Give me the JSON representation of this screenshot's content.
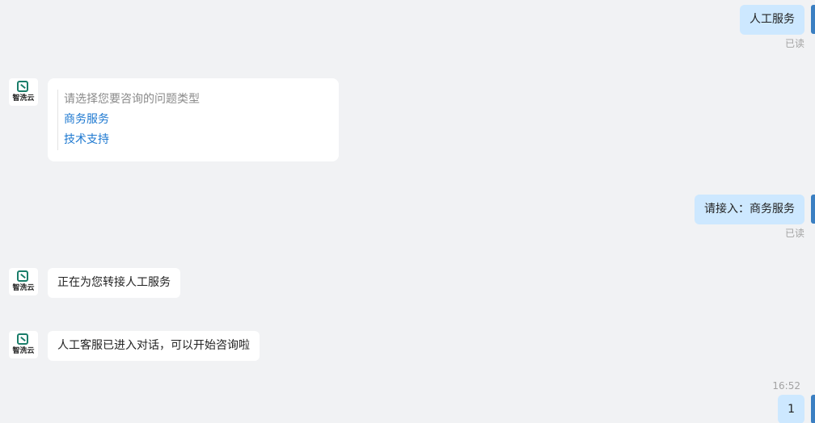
{
  "bot": {
    "name": "智洗云"
  },
  "read_label": "已读",
  "messages": {
    "m1": {
      "sender": "user",
      "text": "人工服务"
    },
    "m2": {
      "sender": "bot",
      "title": "请选择您要咨询的问题类型",
      "options": [
        "商务服务",
        "技术支持"
      ]
    },
    "m3": {
      "sender": "user",
      "text": "请接入：商务服务"
    },
    "m4": {
      "sender": "bot",
      "text": "正在为您转接人工服务"
    },
    "m5": {
      "sender": "bot",
      "text": "人工客服已进入对话，可以开始咨询啦"
    },
    "m6": {
      "sender": "user",
      "time": "16:52",
      "text": "1"
    }
  },
  "colors": {
    "background": "#f1f2f4",
    "user_bubble": "#cde8ff",
    "bot_bubble": "#ffffff",
    "link": "#1d78d0",
    "accent": "#3b7fc2",
    "brand": "#1a7d6a"
  }
}
